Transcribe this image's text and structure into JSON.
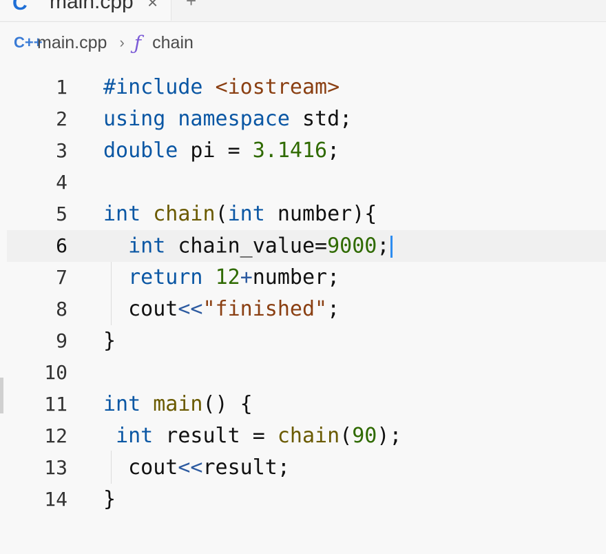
{
  "tab": {
    "icon": "C",
    "label": "main.cpp",
    "close": "×",
    "add": "+"
  },
  "breadcrumb": {
    "file_icon": "C++",
    "file": "main.cpp",
    "separator": "›",
    "func_icon": "ƒ",
    "func": "chain"
  },
  "editor": {
    "current_line": 6,
    "line_numbers": [
      "1",
      "2",
      "3",
      "4",
      "5",
      "6",
      "7",
      "8",
      "9",
      "10",
      "11",
      "12",
      "13",
      "14"
    ],
    "lines": [
      "#include <iostream>",
      "using namespace std;",
      "double pi = 3.1416;",
      "",
      "int chain(int number){",
      "  int chain_value=9000;",
      "  return 12+number;",
      "  cout<<\"finished\";",
      "}",
      "",
      "int main() {",
      " int result = chain(90);",
      "  cout<<result;",
      "}"
    ]
  }
}
